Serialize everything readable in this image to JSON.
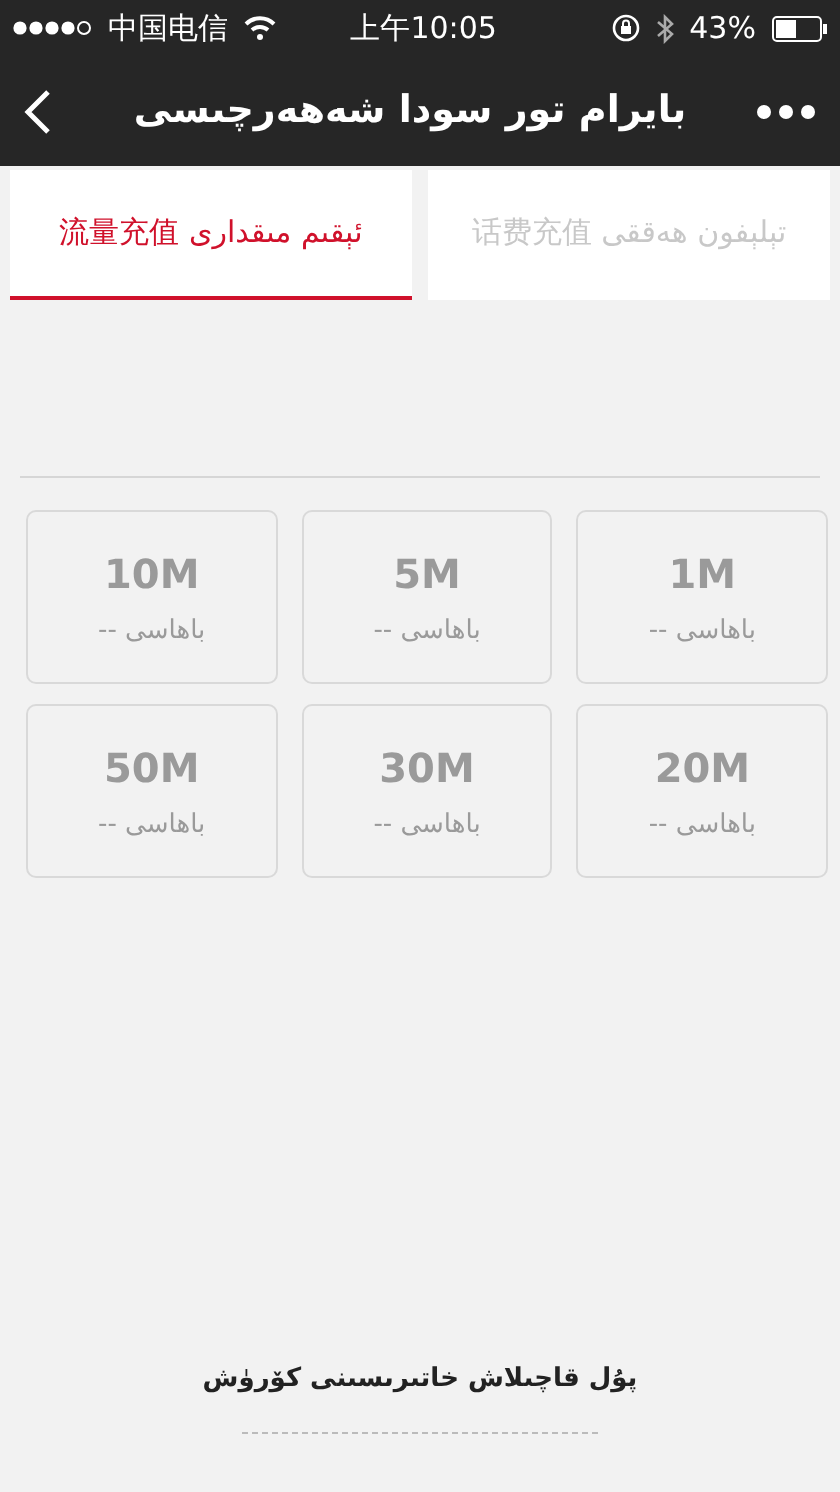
{
  "status_bar": {
    "carrier": "中国电信",
    "time": "上午10:05",
    "battery": "43%"
  },
  "nav": {
    "title": "بايرام تور سودا شەھەرچىسى"
  },
  "tabs": [
    {
      "label": "تېلېفون ھەققى 话费充值",
      "selected": false
    },
    {
      "label": "ئېقىم مىقدارى 流量充值",
      "selected": true
    }
  ],
  "packages": [
    {
      "size": "1M",
      "price": "باھاسى --"
    },
    {
      "size": "5M",
      "price": "باھاسى --"
    },
    {
      "size": "10M",
      "price": "باھاسى --"
    },
    {
      "size": "20M",
      "price": "باھاسى --"
    },
    {
      "size": "30M",
      "price": "باھاسى --"
    },
    {
      "size": "50M",
      "price": "باھاسى --"
    }
  ],
  "footer_link": "پۇل قاچىلاش خاتىرىسىنى كۆرۈش"
}
